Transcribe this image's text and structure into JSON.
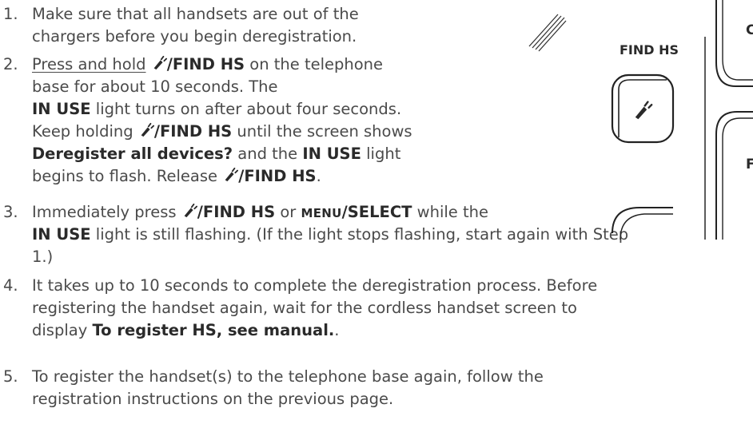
{
  "steps": [
    {
      "num": "1.",
      "l1": "Make sure that all handsets are out of the",
      "l2": "chargers before you begin deregistration."
    },
    {
      "num": "2.",
      "press": "Press and hold",
      "findhs": "/FIND HS",
      "l1_after": " on the telephone",
      "l2": "base for about 10 seconds. The",
      "inuse": "IN USE",
      "l3_after": " light turns on after about four seconds.",
      "l4_pre": "Keep holding ",
      "l4_after": " until the screen shows",
      "dereg": "Deregister all devices?",
      "l5_mid": " and the ",
      "l5_after": " light",
      "l6_pre": "begins to flash. Release ",
      "l6_end": "."
    },
    {
      "num": "3.",
      "l1_pre": "Immediately press ",
      "l1_mid": " or ",
      "menu": "MENU",
      "select": "/SELECT",
      "l1_after": " while the",
      "inuse": "IN USE",
      "l2_after": " light is still flashing. (If the light stops flashing, start again with Step",
      "l3": "1.)"
    },
    {
      "num": "4.",
      "l1": "It takes up to 10 seconds to complete the deregistration process. Before",
      "l2": "registering the handset again, wait for the cordless handset screen to",
      "l3_pre": "display ",
      "l3_bold": "To register HS, see manual.",
      "l3_end": "."
    },
    {
      "num": "5.",
      "l1": "To register the handset(s) to the telephone base again, follow the",
      "l2": "registration instructions on the previous page."
    }
  ],
  "diagram": {
    "button_label": "FIND HS",
    "right_letter_top": "C",
    "right_letter_bottom": "F",
    "icon": "handset-icon"
  }
}
